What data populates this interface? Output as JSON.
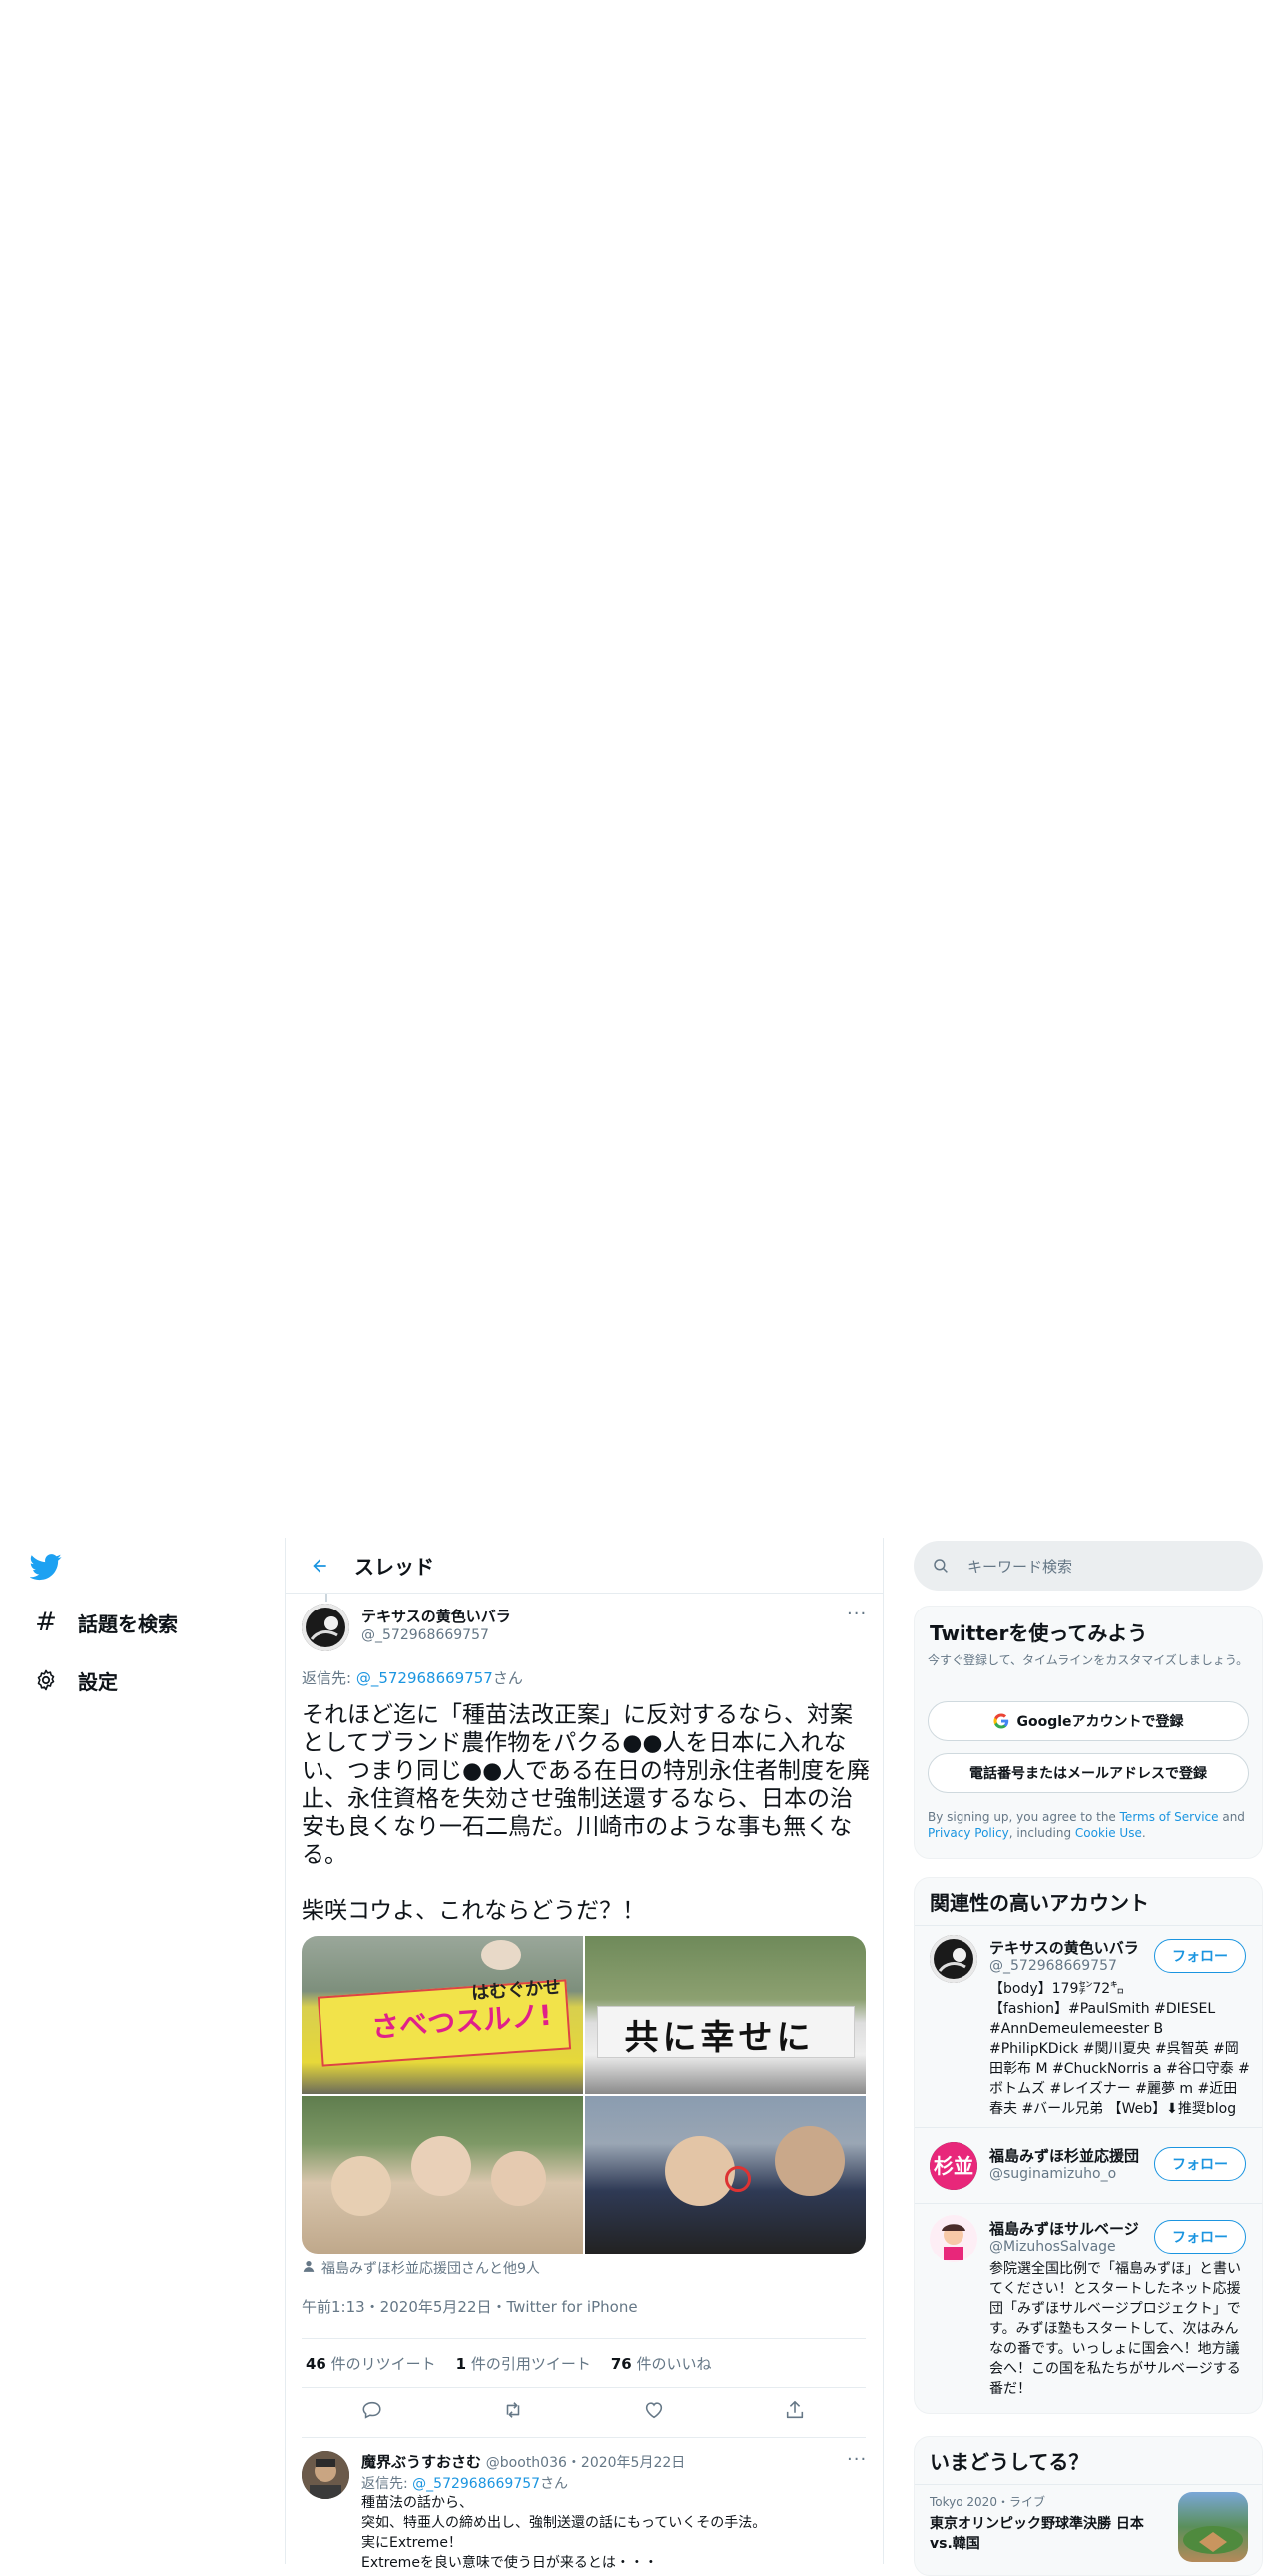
{
  "nav": {
    "explore_label": "話題を検索",
    "settings_label": "設定"
  },
  "header": {
    "title": "スレッド"
  },
  "tweet": {
    "author_name": "テキサスの黄色いバラ",
    "author_handle": "@_572968669757",
    "reply_prefix": "返信先: ",
    "reply_to": "@_572968669757",
    "reply_suffix": "さん",
    "text": "それほど迄に「種苗法改正案」に反対するなら、対案としてブランド農作物をパクる●●人を日本に入れない、つまり同じ●●人である在日の特別永住者制度を廃止、永住資格を失効させ強制送還するなら、日本の治安も良くなり一石二鳥だ。川崎市のような事も無くなる。\n\n柴咲コウよ、これならどうだ？！",
    "media": {
      "img1_banner": "さべつスルノ!",
      "img1_top": "はむぐかせ",
      "img2_banner": "共に幸せに"
    },
    "tagged": "福島みずほ杉並応援団さんと他9人",
    "timestamp": "午前1:13・2020年5月22日・Twitter for iPhone",
    "retweets_count": "46",
    "retweets_label": " 件のリツイート",
    "quotes_count": "1",
    "quotes_label": " 件の引用ツイート",
    "likes_count": "76",
    "likes_label": " 件のいいね"
  },
  "reply": {
    "author_name": "魔界ぶうすおさむ",
    "author_handle": "@booth036",
    "date": "・2020年5月22日",
    "reply_prefix": "返信先: ",
    "reply_to": "@_572968669757",
    "reply_suffix": "さん",
    "line1": "種苗法の話から、",
    "line2": "突如、特亜人の締め出し、強制送還の話にもっていくその手法。",
    "line3": "実にExtreme！",
    "line4": "Extremeを良い意味で使う日が来るとは・・・"
  },
  "search": {
    "placeholder": "キーワード検索"
  },
  "signup": {
    "title": "Twitterを使ってみよう",
    "subtitle": "今すぐ登録して、タイムラインをカスタマイズしましょう。",
    "google_button": "Googleアカウントで登録",
    "phone_button": "電話番号またはメールアドレスで登録",
    "terms_prefix": "By signing up, you agree to the ",
    "terms_link": "Terms of Service",
    "terms_and": " and ",
    "privacy_link": "Privacy Policy",
    "terms_including": ", including ",
    "cookie_link": "Cookie Use",
    "terms_end": "."
  },
  "related": {
    "title": "関連性の高いアカウント",
    "follow_label": "フォロー",
    "accounts": [
      {
        "name": "テキサスの黄色いバラ",
        "handle": "@_572968669757",
        "bio": "【body】179㌢72㌔\n【fashion】#PaulSmith #DIESEL #AnnDemeulemeester B #PhilipKDick #関川夏央 #呉智英 #岡田彰布 M #ChuckNorris a #谷口守泰 #ボトムズ #レイズナー #麗夢 m #近田春夫 #バール兄弟 【Web】⬇推奨blog"
      },
      {
        "name": "福島みずほ杉並応援団",
        "handle": "@suginamizuho_o",
        "bio": ""
      },
      {
        "name": "福島みずほサルベージ",
        "handle": "@MizuhosSalvage",
        "bio": "参院選全国比例で「福島みずほ」と書いてください！とスタートしたネット応援団「みずほサルベージプロジェクト」です。みずほ塾もスタートして、次はみんなの番です。いっしょに国会へ！地方議会へ！この国を私たちがサルベージする番だ！"
      }
    ]
  },
  "trends": {
    "title": "いまどうしてる？",
    "item_meta": "Tokyo 2020・ライブ",
    "item_title": "東京オリンピック野球準決勝 日本 vs.韓国"
  },
  "colors": {
    "accent": "#1b95e0",
    "border": "#e6ecf0",
    "muted": "#657786"
  },
  "icons": [
    "twitter-logo-icon",
    "hash-icon",
    "gear-icon",
    "back-arrow-icon",
    "more-icon",
    "reply-icon",
    "retweet-icon",
    "like-icon",
    "share-icon",
    "search-icon",
    "google-icon",
    "person-icon"
  ]
}
